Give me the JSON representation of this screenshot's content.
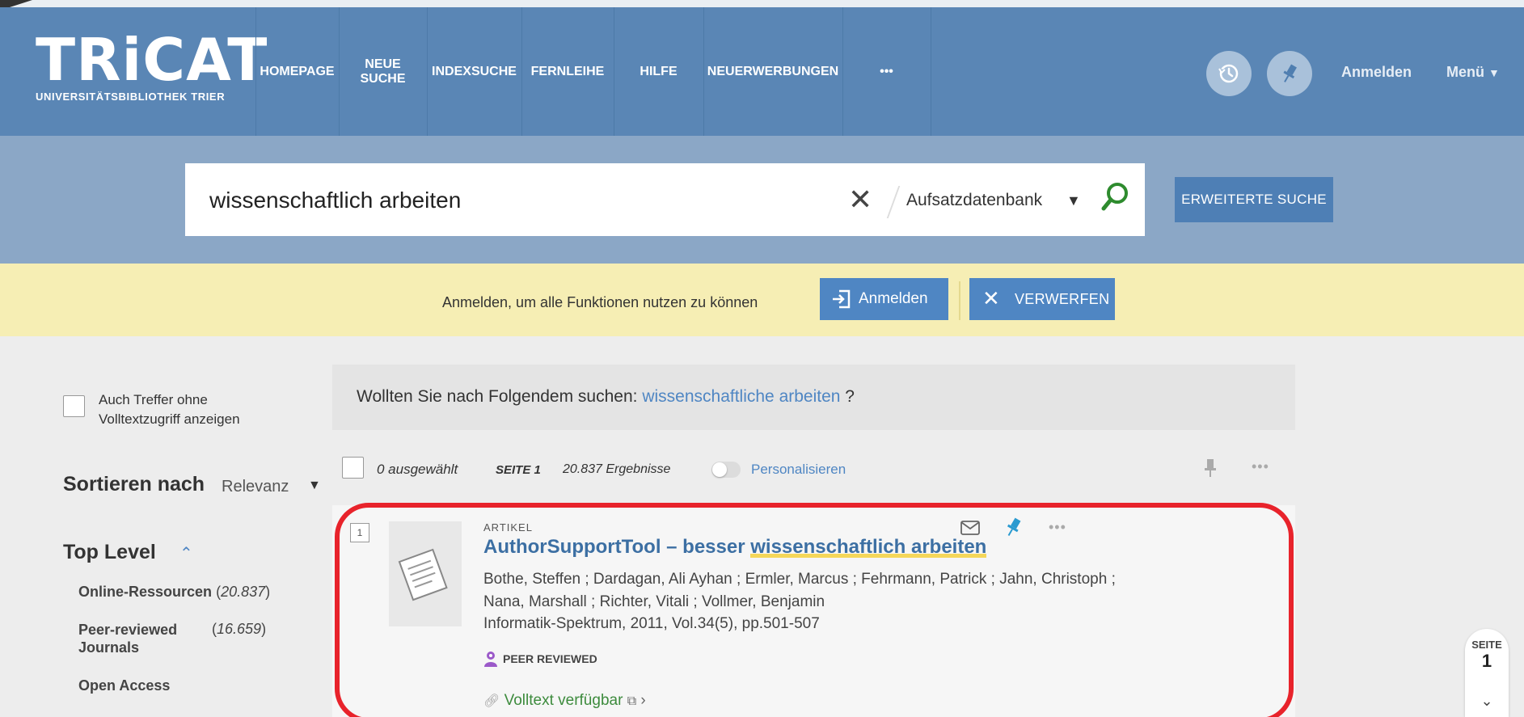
{
  "header": {
    "logo_text": "TRiCAT",
    "logo_subtitle": "UNIVERSITÄTSBIBLIOTHEK TRIER",
    "nav": {
      "homepage": "HOMEPAGE",
      "neue_line1": "NEUE",
      "neue_line2": "SUCHE",
      "indexsuche": "INDEXSUCHE",
      "fernleihe": "FERNLEIHE",
      "hilfe": "HILFE",
      "neuerwerbungen": "NEUERWERBUNGEN",
      "more": "•••"
    },
    "login_link": "Anmelden",
    "menu_link": "Menü"
  },
  "search": {
    "query": "wissenschaftlich arbeiten",
    "scope": "Aufsatzdatenbank",
    "advanced_button": "ERWEITERTE SUCHE"
  },
  "banner": {
    "text": "Anmelden, um alle Funktionen nutzen zu können",
    "login_button": "Anmelden",
    "dismiss_button": "VERWERFEN"
  },
  "facets": {
    "fulltext_toggle_line1": "Auch Treffer ohne",
    "fulltext_toggle_line2": "Volltextzugriff anzeigen",
    "sort_label": "Sortieren nach",
    "sort_value": "Relevanz",
    "top_level_title": "Top Level",
    "items": [
      {
        "name": "Online-Ressourcen",
        "count": "20.837"
      },
      {
        "name_line1": "Peer-reviewed",
        "name_line2": "Journals",
        "count": "16.659"
      },
      {
        "name": "Open Access"
      }
    ]
  },
  "did_you_mean": {
    "prefix": "Wollten Sie nach Folgendem suchen: ",
    "suggestion": "wissenschaftliche arbeiten",
    "suffix": " ?"
  },
  "results_bar": {
    "selected": "0 ausgewählt",
    "page": "SEITE 1",
    "count": "20.837 Ergebnisse",
    "personalize": "Personalisieren"
  },
  "result": {
    "number": "1",
    "type": "ARTIKEL",
    "title_plain": "AuthorSupportTool – besser ",
    "title_highlight": "wissenschaftlich arbeiten",
    "authors_line1": "Bothe, Steffen ; Dardagan, Ali Ayhan ; Ermler, Marcus ; Fehrmann, Patrick ; Jahn, Christoph ;",
    "authors_line2": "Nana, Marshall ; Richter, Vitali ; Vollmer, Benjamin",
    "source": "Informatik-Spektrum, 2011, Vol.34(5), pp.501-507",
    "badge": "PEER REVIEWED",
    "fulltext_link": "Volltext verfügbar"
  },
  "page_indicator": {
    "label": "SEITE",
    "number": "1"
  },
  "colors": {
    "header_bg": "#5a86b5",
    "search_band": "#8ba7c6",
    "banner_bg": "#f6eeb4",
    "accent": "#4f86c3",
    "highlight_frame": "#e8232b"
  }
}
